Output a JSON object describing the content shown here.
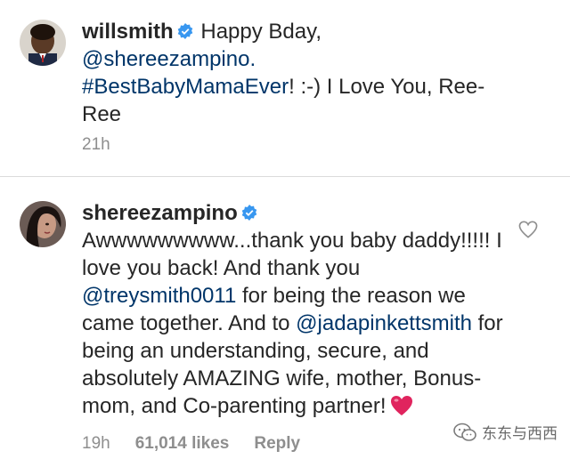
{
  "comments": [
    {
      "username": "willsmith",
      "verified": true,
      "text_parts": [
        {
          "type": "text",
          "value": "Happy Bday,"
        },
        {
          "type": "mention",
          "value": "@shereezampino."
        },
        {
          "type": "hashtag",
          "value": "#BestBabyMamaEver"
        },
        {
          "type": "text",
          "value": "! :-) I Love You, Ree-Ree"
        }
      ],
      "time": "21h"
    },
    {
      "username": "shereezampino",
      "verified": true,
      "text_parts": [
        {
          "type": "text",
          "value": "Awwwwwwwww...thank you baby daddy!!!!! I love you back! And thank you "
        },
        {
          "type": "mention",
          "value": "@treysmith0011"
        },
        {
          "type": "text",
          "value": " for being the reason we came together. And to "
        },
        {
          "type": "mention",
          "value": "@jadapinkettsmith"
        },
        {
          "type": "text",
          "value": " for being an understanding, secure, and absolutely AMAZING wife, mother, Bonus-mom, and Co-parenting partner!"
        }
      ],
      "time": "19h",
      "likes": "61,014 likes",
      "reply_label": "Reply"
    }
  ],
  "watermark": "东东与西西",
  "colors": {
    "text": "#262626",
    "mention": "#003569",
    "meta": "#8e8e8e",
    "verified": "#3897f0",
    "heart": "#e0245e"
  }
}
